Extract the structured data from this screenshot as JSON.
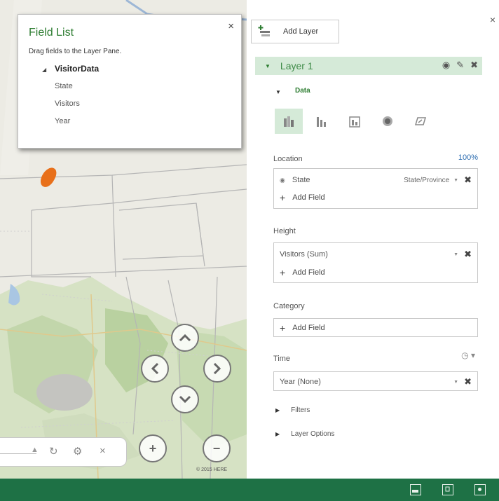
{
  "field_list": {
    "title": "Field List",
    "close_glyph": "×",
    "hint": "Drag fields to the Layer Pane.",
    "table_name": "VisitorData",
    "fields": [
      "State",
      "Visitors",
      "Year"
    ]
  },
  "map": {
    "copyright": "© 2015 HERE",
    "nav": {
      "up": "⌃",
      "left": "<",
      "right": ">",
      "down": "⌄",
      "zoom_in": "+",
      "zoom_out": "−"
    },
    "search_icons": {
      "refresh": "↻",
      "settings": "⚙",
      "clear": "×"
    }
  },
  "pane": {
    "close_glyph": "×",
    "add_layer_label": "Add Layer",
    "layer_name": "Layer 1",
    "data_section": "Data",
    "location": {
      "label": "Location",
      "percent": "100%",
      "field_value": "State",
      "field_type": "State/Province",
      "add_field": "Add Field"
    },
    "height": {
      "label": "Height",
      "field_value": "Visitors (Sum)",
      "add_field": "Add Field"
    },
    "category": {
      "label": "Category",
      "add_field": "Add Field"
    },
    "time": {
      "label": "Time",
      "field_value": "Year (None)"
    },
    "filters_label": "Filters",
    "layer_options_label": "Layer Options"
  },
  "colors": {
    "status_bar": "#1e7145",
    "accent_green": "#2e7d32",
    "layer_highlight": "#d5ead8",
    "marker": "#e8701a"
  }
}
